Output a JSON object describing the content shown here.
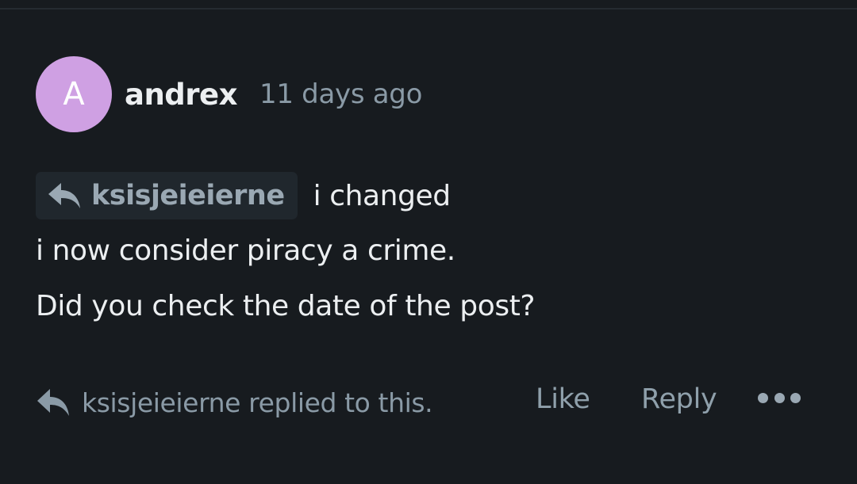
{
  "comment": {
    "avatar_letter": "A",
    "author": "andrex",
    "timestamp": "11 days ago",
    "reply_to_user": "ksisjeieierne",
    "reply_text": "i changed",
    "body_lines": [
      "i now consider piracy a crime.",
      "Did you check the date of the post?"
    ]
  },
  "footer": {
    "replied_notice": "ksisjeieierne replied to this.",
    "like_label": "Like",
    "reply_label": "Reply"
  },
  "icons": {
    "reply_arrow": "reply-arrow-icon",
    "more": "more-dots-icon"
  },
  "colors": {
    "background": "#171b1f",
    "avatar": "#cfa0e3",
    "primary_text": "#eceff1",
    "muted_text": "#8a9aa6",
    "chip_background": "#20272d"
  }
}
